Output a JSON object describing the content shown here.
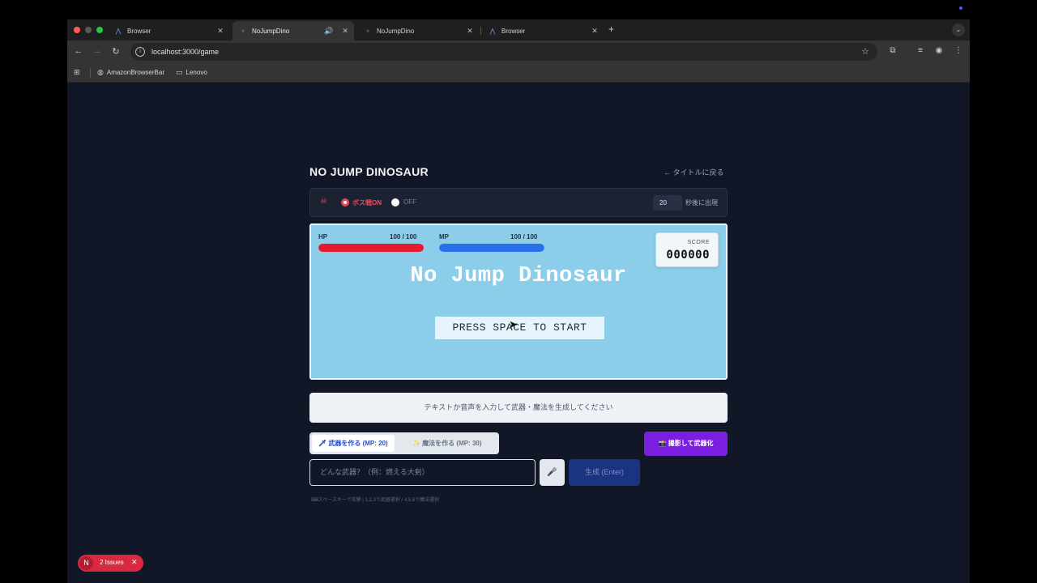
{
  "browser": {
    "tabs": [
      {
        "label": "Browser",
        "icon": "browser-logo-icon"
      },
      {
        "label": "NoJumpDino",
        "icon": "dino-favicon-icon",
        "audio": "🔊",
        "active": true
      },
      {
        "label": "NoJumpDino",
        "icon": "dino-favicon-icon"
      },
      {
        "label": "Browser",
        "icon": "browser-logo-icon"
      }
    ],
    "close_glyph": "✕",
    "new_tab_glyph": "+",
    "url": "localhost:3000/game",
    "bookmarks": [
      {
        "label": "AmazonBrowserBar",
        "icon": "globe-icon"
      },
      {
        "label": "Lenovo",
        "icon": "folder-icon"
      }
    ]
  },
  "game": {
    "title": "NO JUMP DINOSAUR",
    "back_link": "← タイトルに戻る",
    "boss": {
      "on_label": "ボス戦ON",
      "off_label": "OFF",
      "seconds": "20",
      "seconds_suffix": "秒後に出現"
    },
    "hp": {
      "label": "HP",
      "value": "100 / 100",
      "fraction": 1.0,
      "color": "#e5192f"
    },
    "mp": {
      "label": "MP",
      "value": "100 / 100",
      "fraction": 1.0,
      "color": "#2b6fea"
    },
    "score": {
      "label": "SCORE",
      "value": "000000"
    },
    "canvas_title": "No Jump Dinosaur",
    "start_prompt": "PRESS SPACE TO START",
    "hint": "テキストか音声を入力して武器・魔法を生成してください",
    "mode_tabs": {
      "weapon": "🗡 武器を作る (MP: 20)",
      "magic": "✨ 魔法を作る (MP: 30)"
    },
    "photo_button": "📸 撮影して武器化",
    "input_placeholder": "どんな武器？（例：燃える大剣）",
    "mic": "🎤",
    "generate_button": "生成 (Enter)",
    "key_hint": "⌨スペースキーで攻撃 | 1,2,3で武器選択 / 4,5,6で魔法選択"
  },
  "devtools": {
    "badge": "N",
    "issues": "2 Issues",
    "close": "✕"
  },
  "colors": {
    "page_bg": "#111727",
    "canvas_bg": "#8cceea",
    "accent_purple": "#7a1fe0",
    "accent_red": "#e9445b"
  }
}
